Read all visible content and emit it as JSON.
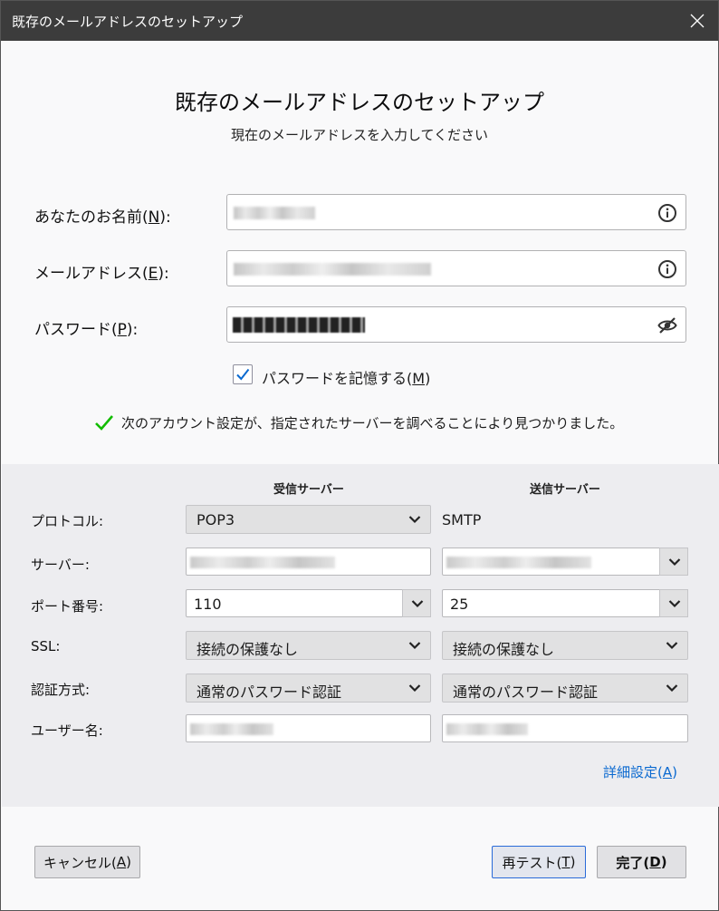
{
  "window": {
    "title": "既存のメールアドレスのセットアップ"
  },
  "header": {
    "title": "既存のメールアドレスのセットアップ",
    "subtitle": "現在のメールアドレスを入力してください"
  },
  "form": {
    "name_label": "あなたのお名前(",
    "name_key": "N",
    "name_close": "):",
    "email_label": "メールアドレス(",
    "email_key": "E",
    "email_close": "):",
    "password_label": "パスワード(",
    "password_key": "P",
    "password_close": "):",
    "remember_label": "パスワードを記憶する(",
    "remember_key": "M",
    "remember_close": ")",
    "remember_checked": true
  },
  "status": {
    "message": "次のアカウント設定が、指定されたサーバーを調べることにより見つかりました。"
  },
  "config": {
    "incoming_header": "受信サーバー",
    "outgoing_header": "送信サーバー",
    "protocol_label": "プロトコル:",
    "server_label": "サーバー:",
    "port_label": "ポート番号:",
    "ssl_label": "SSL:",
    "auth_label": "認証方式:",
    "username_label": "ユーザー名:",
    "incoming": {
      "protocol": "POP3",
      "port": "110",
      "ssl": "接続の保護なし",
      "auth": "通常のパスワード認証"
    },
    "outgoing": {
      "protocol": "SMTP",
      "port": "25",
      "ssl": "接続の保護なし",
      "auth": "通常のパスワード認証"
    },
    "advanced_label": "詳細設定(",
    "advanced_key": "A",
    "advanced_close": ")"
  },
  "buttons": {
    "cancel_label": "キャンセル(",
    "cancel_key": "A",
    "cancel_close": ")",
    "retest_label": "再テスト(",
    "retest_key": "T",
    "retest_close": ")",
    "done_label": "完了(",
    "done_key": "D",
    "done_close": ")"
  },
  "colors": {
    "accent": "#0a69d0",
    "success": "#12bc00",
    "titlebar": "#3c3c3c"
  },
  "icons": [
    "close-icon",
    "info-icon",
    "eye-slash-icon",
    "checkmark-icon",
    "chevron-down-icon"
  ]
}
